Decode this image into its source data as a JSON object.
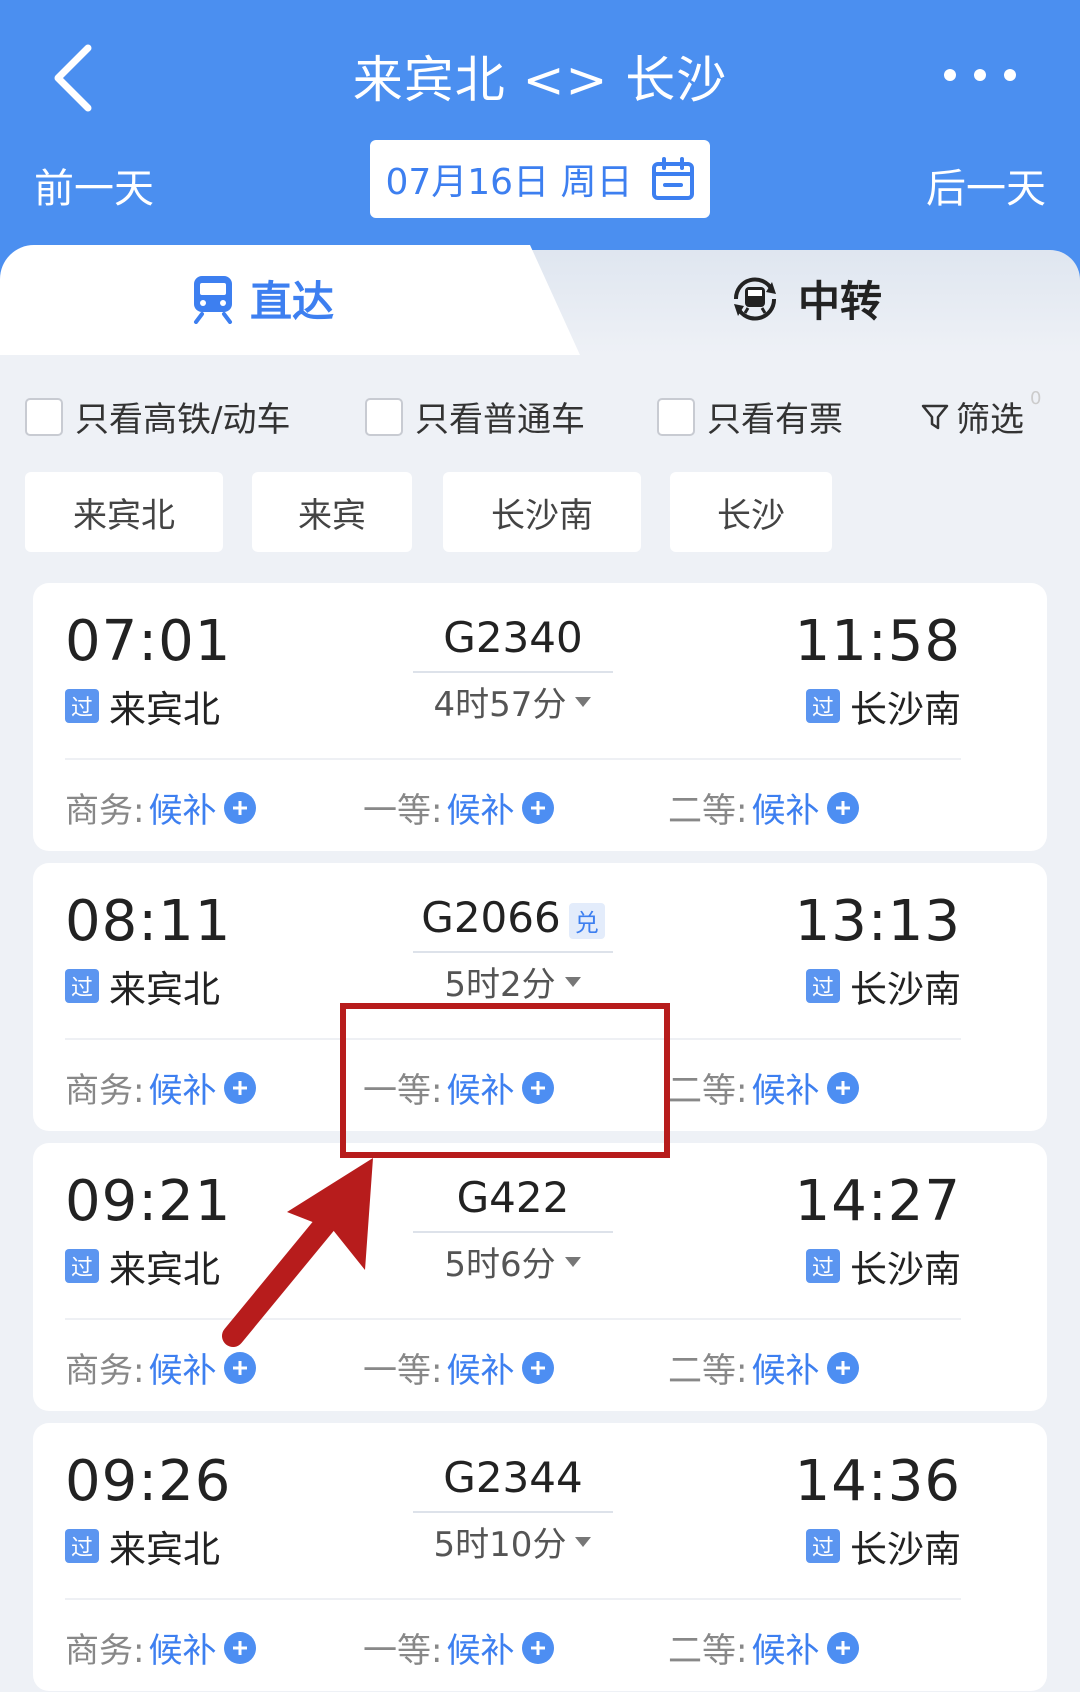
{
  "header": {
    "title": "来宾北 <> 长沙",
    "prev_day": "前一天",
    "next_day": "后一天",
    "date": "07月16日 周日"
  },
  "tabs": {
    "direct": "直达",
    "transfer": "中转"
  },
  "filters": {
    "high_speed": "只看高铁/动车",
    "normal": "只看普通车",
    "has_ticket": "只看有票",
    "filter": "筛选",
    "filter_count": "0"
  },
  "stations": [
    "来宾北",
    "来宾",
    "长沙南",
    "长沙"
  ],
  "seat_labels": {
    "business": "商务:",
    "first": "一等:",
    "second": "二等:",
    "waitlist": "候补"
  },
  "pass_badge": "过",
  "trains": [
    {
      "dep_time": "07:01",
      "dep_station": "来宾北",
      "train_no": "G2340",
      "duration": "4时57分",
      "arr_time": "11:58",
      "arr_station": "长沙南"
    },
    {
      "dep_time": "08:11",
      "dep_station": "来宾北",
      "train_no": "G2066",
      "badge": "兑",
      "duration": "5时2分",
      "arr_time": "13:13",
      "arr_station": "长沙南"
    },
    {
      "dep_time": "09:21",
      "dep_station": "来宾北",
      "train_no": "G422",
      "duration": "5时6分",
      "arr_time": "14:27",
      "arr_station": "长沙南"
    },
    {
      "dep_time": "09:26",
      "dep_station": "来宾北",
      "train_no": "G2344",
      "duration": "5时10分",
      "arr_time": "14:36",
      "arr_station": "长沙南"
    }
  ],
  "colors": {
    "header_bg": "#4b8ff0",
    "accent": "#3d7ff0",
    "annotation": "#b71c1c"
  }
}
